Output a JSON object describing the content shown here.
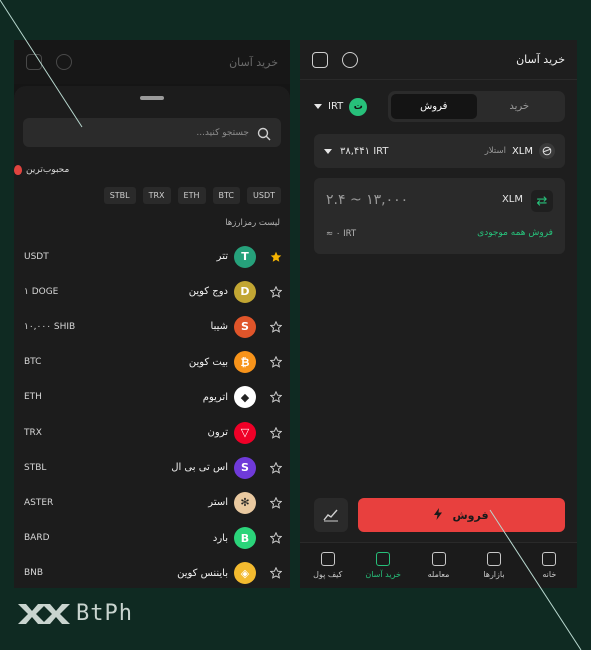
{
  "left": {
    "header_title": "خرید آسان",
    "search": {
      "placeholder": "جستجو کنید..."
    },
    "favorites": {
      "title": "محبوب‌ترین",
      "chips": [
        "USDT",
        "BTC",
        "ETH",
        "TRX",
        "STBL"
      ]
    },
    "list_title": "لیست رمزارزها",
    "coins": [
      {
        "name": "تتر",
        "symbol": "USDT",
        "starred": true,
        "color": "#26a17b",
        "glyph": "T"
      },
      {
        "name": "دوج کوین",
        "symbol": "۱ DOGE",
        "starred": false,
        "color": "#c2a633",
        "glyph": "D"
      },
      {
        "name": "شیبا",
        "symbol": "۱۰,۰۰۰ SHIB",
        "starred": false,
        "color": "#e0552a",
        "glyph": "S"
      },
      {
        "name": "بیت کوین",
        "symbol": "BTC",
        "starred": false,
        "color": "#f7931a",
        "glyph": "₿"
      },
      {
        "name": "اتریوم",
        "symbol": "ETH",
        "starred": false,
        "color": "#ffffff",
        "glyph": "◆"
      },
      {
        "name": "ترون",
        "symbol": "TRX",
        "starred": false,
        "color": "#ef0027",
        "glyph": "▽"
      },
      {
        "name": "اس تی بی ال",
        "symbol": "STBL",
        "starred": false,
        "color": "#6f3ad9",
        "glyph": "S"
      },
      {
        "name": "استر",
        "symbol": "ASTER",
        "starred": false,
        "color": "#e9c9a0",
        "glyph": "✻"
      },
      {
        "name": "بارد",
        "symbol": "BARD",
        "starred": false,
        "color": "#2bd47a",
        "glyph": "B"
      },
      {
        "name": "بایننس کوین",
        "symbol": "BNB",
        "starred": false,
        "color": "#f3ba2f",
        "glyph": "◈"
      }
    ]
  },
  "right": {
    "header_title": "خرید آسان",
    "currency": "IRT",
    "tabs": {
      "buy": "خرید",
      "sell": "فروش",
      "active": "sell"
    },
    "pair": {
      "symbol": "XLM",
      "name": "استلار",
      "price": "۳۸,۴۴۱ IRT"
    },
    "amount_placeholder": "۲.۴ ~ ۱۳,۰۰۰",
    "card_symbol": "XLM",
    "balance": "≈ ۰ IRT",
    "sell_all": "فروش همه موجودی",
    "sell_button": "فروش",
    "nav": [
      {
        "label": "خانه",
        "active": false
      },
      {
        "label": "بازارها",
        "active": false
      },
      {
        "label": "معامله",
        "active": false
      },
      {
        "label": "خرید آسان",
        "active": true
      },
      {
        "label": "کیف پول",
        "active": false
      }
    ]
  },
  "brand": {
    "name": "BtPh"
  },
  "colors": {
    "accent_green": "#27c07a",
    "sell_red": "#e8403e",
    "background": "#0f2a22"
  }
}
